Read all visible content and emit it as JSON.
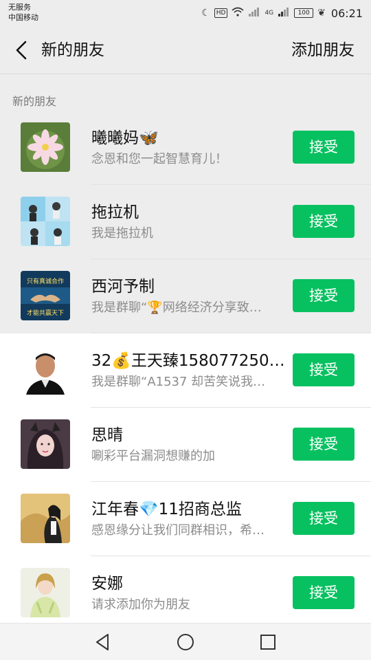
{
  "status_bar": {
    "carrier_line1": "无服务",
    "carrier_line2": "中国移动",
    "hd": "HD",
    "network": "4G",
    "battery": "100",
    "time": "06:21",
    "icons": [
      "moon-icon",
      "wifi-icon",
      "signal-icon",
      "leaf-icon"
    ]
  },
  "header": {
    "title": "新的朋友",
    "action_label": "添加朋友",
    "back_icon": "back-arrow-icon"
  },
  "section_label": "新的朋友",
  "requests": [
    {
      "name": "曦曦妈🦋",
      "message": "念恩和您一起智慧育儿！",
      "button": "接受",
      "background": "gray"
    },
    {
      "name": "拖拉机",
      "message": "我是拖拉机",
      "button": "接受",
      "background": "gray"
    },
    {
      "name": "西河予制",
      "message": "我是群聊“🏆网络经济分享致…",
      "button": "接受",
      "background": "gray"
    },
    {
      "name": "32💰王天臻158077250…",
      "message": "我是群聊“A1537 却苦笑说我…",
      "button": "接受",
      "background": "white"
    },
    {
      "name": "思晴",
      "message": "唰彩平台漏洞想赚的加",
      "button": "接受",
      "background": "white"
    },
    {
      "name": "江年春💎11招商总监",
      "message": "感恩缘分让我们同群相识，希…",
      "button": "接受",
      "background": "white"
    },
    {
      "name": "安娜",
      "message": "请求添加你为朋友",
      "button": "接受",
      "background": "white"
    }
  ],
  "avatar_texts": {
    "row3_top": "只有真诚合作",
    "row3_bottom": "才能共赢天下"
  },
  "system_nav": [
    "back-triangle-icon",
    "home-circle-icon",
    "recents-square-icon"
  ],
  "colors": {
    "accent": "#07c160",
    "background": "#ededed",
    "row_white": "#ffffff",
    "secondary_text": "#8c8c8c"
  }
}
